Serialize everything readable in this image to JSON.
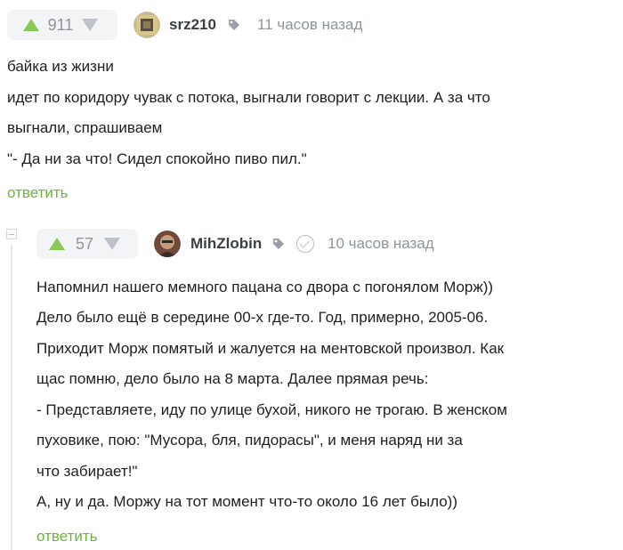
{
  "comments": [
    {
      "rating": "911",
      "username": "srz210",
      "time": "11 часов назад",
      "lines": [
        "байка из жизни",
        "идет по коридору чувак с потока, выгнали говорит с лекции. А за что",
        "выгнали, спрашиваем",
        "\"- Да ни за что! Сидел спокойно пиво пил.\""
      ],
      "reply_label": "ответить"
    },
    {
      "rating": "57",
      "username": "MihZlobin",
      "time": "10 часов назад",
      "lines": [
        "Напомнил нашего мемного пацана со двора с погонялом Морж))",
        "Дело было ещё в середине 00-х где-то. Год, примерно, 2005-06.",
        "Приходит Морж помятый и жалуется на ментовской произвол. Как",
        "щас помню, дело было на 8 марта. Далее прямая речь:",
        "- Представляете, иду по улице бухой, никого не трогаю. В женском",
        "пуховике, пою: \"Мусора, бля, пидорасы\", и меня наряд ни за",
        "что забирает!\"",
        "А, ну и да. Моржу на тот момент что-то около 16 лет было))"
      ],
      "reply_label": "ответить"
    }
  ],
  "colors": {
    "upvote": "#8ac858",
    "reply": "#6cb53b",
    "muted": "#8f959a"
  }
}
